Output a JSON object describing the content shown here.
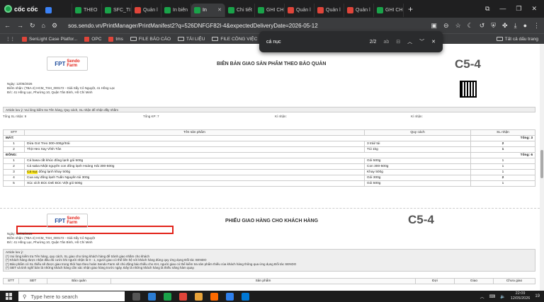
{
  "browser": {
    "brand": "cốc cốc",
    "tabs": [
      {
        "label": "",
        "color": "#3b82f6"
      },
      {
        "label": "THEO",
        "color": "#1aa34a"
      },
      {
        "label": "SFC_TI",
        "color": "#1aa34a"
      },
      {
        "label": "Quản l",
        "color": "#e0453a"
      },
      {
        "label": "In biên",
        "color": "#1aa34a"
      },
      {
        "label": "In",
        "color": "#1aa34a",
        "active": true
      },
      {
        "label": "Chi tiết",
        "color": "#1aa34a"
      },
      {
        "label": "GHI CH",
        "color": "#1aa34a"
      },
      {
        "label": "Quản l",
        "color": "#e0453a"
      },
      {
        "label": "Quản l",
        "color": "#e0453a"
      },
      {
        "label": "Quản l",
        "color": "#e0453a"
      },
      {
        "label": "GHI CH",
        "color": "#1aa34a"
      }
    ],
    "url": "sos.sendo.vn/PrintManager/PrintManifest2?q=526DNFGF82I-4&expectedDeliveryDate=2026-05-12",
    "bookmarks": [
      "SenLight Case Platfor...",
      "OPC",
      "tms",
      "FILE BÁO CÁO",
      "TÀI LIỆU",
      "FILE CÔNG VIỆC"
    ],
    "bookmarks_right": "Tất cả dấu trang",
    "find": {
      "query": "cá nục",
      "count": "2/2",
      "aa": "ab"
    }
  },
  "doc1": {
    "title": "BIÊN BẢN GIAO SẢN PHẨM THEO BẢO QUẢN",
    "code": "C5-4",
    "date": "Ngày: 12/05/2026",
    "depot": "Điểm nhận: (TBA-2) HCM_TSH_000172 - Giải Sấy Cô Nguyệt, 41 Hồng Lạc",
    "address": "Đ/c: 41 Hồng Lạc, Phường 10, Quận Tân Bình, Hồ Chí Minh",
    "note": "Article lưu ý: Vui lòng kiểm tra Tên hàng, Quy cách, SL nhận để nhận đầy nhầm",
    "summary": [
      "Tổng SL nhận: 9",
      "Tổng KP: 7",
      "Kí nhận:",
      "Kí nhận:"
    ],
    "headers": [
      "STT",
      "Tên sản phẩm",
      "Quy cách",
      "SL nhận"
    ],
    "groups": [
      {
        "name": "MÁT:",
        "total": "Tổng: 3",
        "rows": [
          {
            "stt": "1",
            "name": "Dừa Got Treo 300-400gr/trái",
            "spec": "3 trái/ túi",
            "qty": "2"
          },
          {
            "stt": "2",
            "name": "Thịt Heo Xay Vĩnh Tân",
            "spec": "Túi 1kg",
            "qty": "1"
          }
        ]
      },
      {
        "name": "ĐÔNG:",
        "total": "Tổng: 6",
        "rows": [
          {
            "stt": "1",
            "name": "Cá basa cắt khúc đông lạnh gói 500g",
            "spec": "Gói 500g",
            "qty": "1"
          },
          {
            "stt": "2",
            "name": "Cá saba Nhật nguyên con đông lạnh Hoàng Hải 300-500g",
            "spec": "Con 300-500g",
            "qty": "1"
          },
          {
            "stt": "3",
            "hl": "Cá nục",
            "name": " đông lạnh khay 500g",
            "spec": "Khay 500g",
            "qty": "1"
          },
          {
            "stt": "4",
            "name": "Cua xay đông lạnh Tuấn Nguyên túi 300g",
            "spec": "Gói 300g",
            "qty": "2"
          },
          {
            "stt": "5",
            "name": "Xúc xích Đức Deli Đức Việt gói 500g",
            "spec": "Gói 500g",
            "qty": "1"
          }
        ]
      }
    ]
  },
  "doc2": {
    "title": "PHIẾU GIAO HÀNG CHO KHÁCH HÀNG",
    "code": "C5-4",
    "date": "Ngày: 12/05/2026",
    "depot": "Điểm nhận: (TBA-2) HCM_TSH_000172 - Giải Sấy Cô Nguyệt",
    "address": "Đ/c: 41 Hồng Lạc, Phường 10, Quận Tân Bình, Hồ Chí Minh",
    "notes": [
      "Article lưu ý:",
      "(*) Vui lòng kiểm tra Tên hàng, quy cách, SL giao cho từng khách hàng để tránh giao nhầm cho khách",
      "(*) Khách hàng được nhận đầu đủ cước khi người nhận là 0 - 1, người giao có thể liên hệ với khách hàng đúng quy ứng dụng Đối tác SENDO",
      "(*) Bảo phẩm có SL thiếu sẽ được giao trong thời hạn theo hoàn Sendo Farm sẽ chủ động báo thiếu cho KH, người giao có thể kiểm tra sản phẩm thiếu của khách hàng thông qua ứng dụng Đối tác SENDO",
      "(*) SĐT và tinh nghĩ bán là những khách hàng cần xác nhận giao hàng trước ngày. Đây là những khách hàng là thiếu năng hàm quay."
    ],
    "headers": [
      "STT",
      "SĐT",
      "Bảo quản",
      "Sản phẩm",
      "Đợi",
      "Giao",
      "Chưa giao"
    ]
  },
  "taskbar": {
    "search": "Type here to search",
    "time": "22:09",
    "date": "12/05/2026",
    "notif": "19"
  }
}
